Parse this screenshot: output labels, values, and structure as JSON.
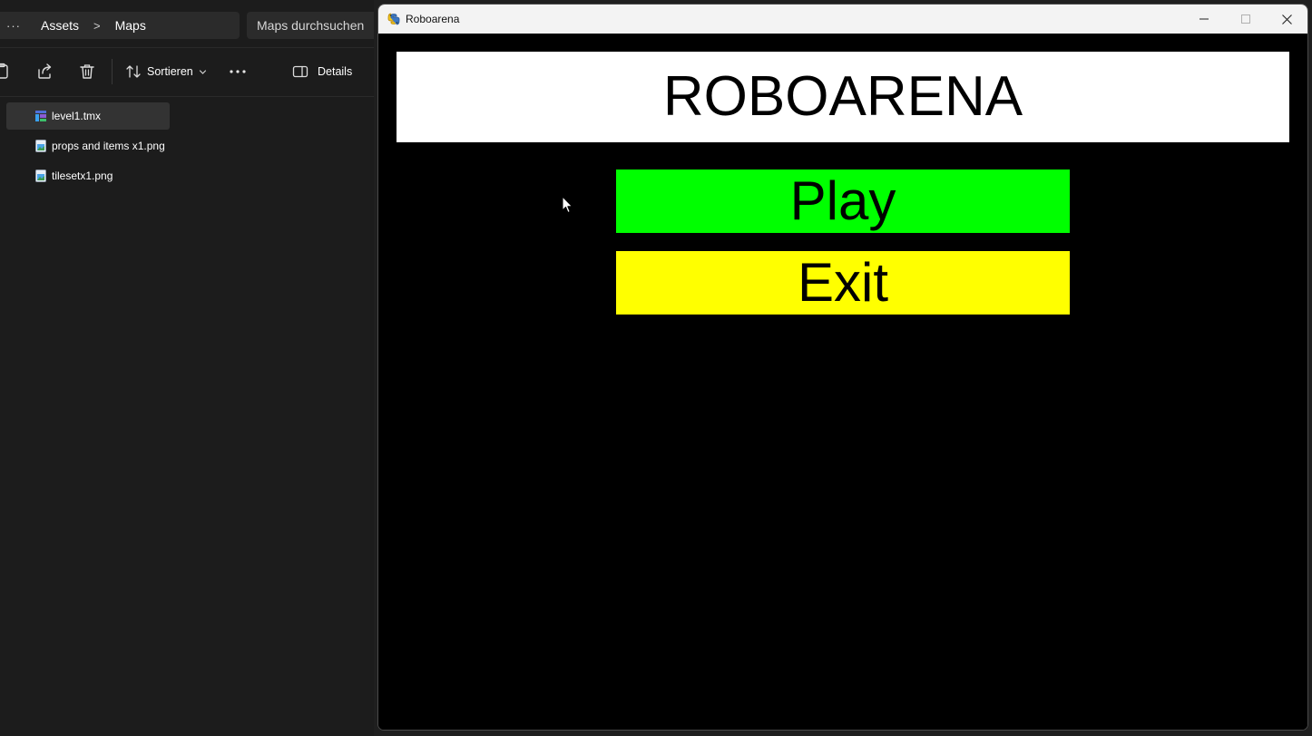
{
  "explorer": {
    "address": {
      "more": "···",
      "crumbs": [
        "Assets",
        "Maps"
      ],
      "separator": ">"
    },
    "search": {
      "placeholder": "Maps durchsuchen"
    },
    "toolbar": {
      "sort_label": "Sortieren",
      "more_label": "···",
      "details_label": "Details"
    },
    "files": [
      {
        "name": "level1.tmx",
        "icon": "tmx-file-icon",
        "selected": true
      },
      {
        "name": "props and items x1.png",
        "icon": "png-file-icon",
        "selected": false
      },
      {
        "name": "tilesetx1.png",
        "icon": "png-file-icon",
        "selected": false
      }
    ]
  },
  "game_window": {
    "title": "Roboarena",
    "game_title": "ROBOARENA",
    "buttons": {
      "play": "Play",
      "exit": "Exit"
    },
    "colors": {
      "background": "#000000",
      "banner": "#ffffff",
      "play": "#00ff00",
      "exit": "#ffff00",
      "text": "#000000"
    }
  }
}
